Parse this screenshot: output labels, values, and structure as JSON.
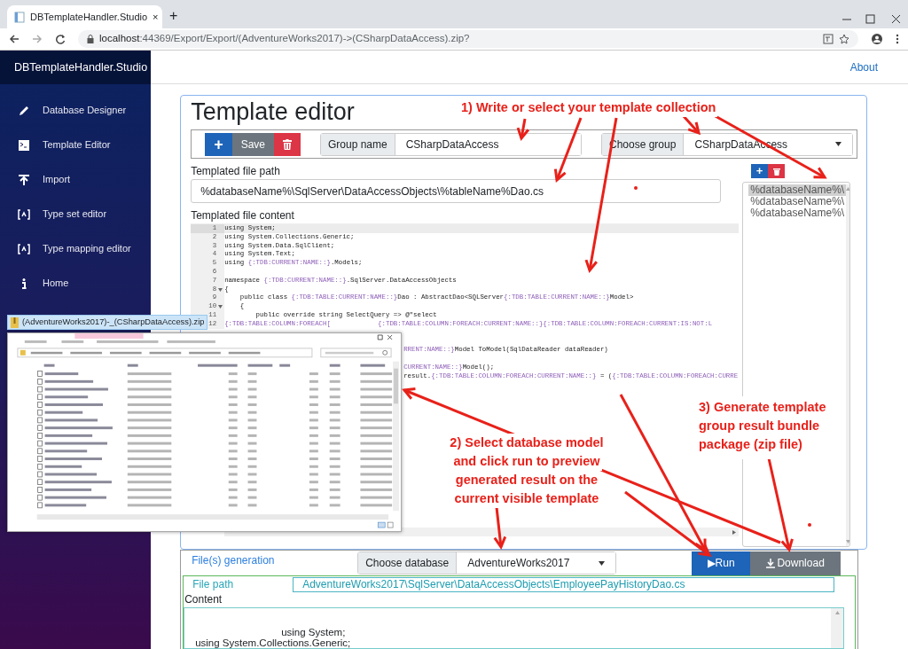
{
  "browser": {
    "tab_title": "DBTemplateHandler.Studio",
    "tab_close": "×",
    "new_tab": "+",
    "url_host": "localhost",
    "url_path": ":44369/Export/Export/(AdventureWorks2017)->(CSharpDataAccess).zip?"
  },
  "sidebar": {
    "brand": "DBTemplateHandler.Studio",
    "items": [
      {
        "label": "Database Designer",
        "kind": "pencil"
      },
      {
        "label": "Template Editor",
        "kind": "terminal"
      },
      {
        "label": "Import",
        "kind": "upload"
      },
      {
        "label": "Type set editor",
        "kind": "brackets"
      },
      {
        "label": "Type mapping editor",
        "kind": "brackets"
      },
      {
        "label": "Home",
        "kind": "info"
      }
    ]
  },
  "top_link": "About",
  "editor": {
    "title": "Template editor",
    "toolbar": {
      "add": "+",
      "save": "Save",
      "group_name_label": "Group name",
      "group_name": "CSharpDataAccess",
      "choose_group_label": "Choose group",
      "choose_group": "CSharpDataAccess"
    },
    "path_label": "Templated file path",
    "path": "%databaseName%\\SqlServer\\DataAccessObjects\\%tableName%Dao.cs",
    "content_label": "Templated file content",
    "list_add": "+",
    "templates": [
      {
        "label": "%databaseName%\\",
        "selected": true
      },
      {
        "label": "%databaseName%\\",
        "selected": false
      },
      {
        "label": "%databaseName%\\",
        "selected": false
      }
    ],
    "code": [
      {
        "number": "1",
        "selected": true,
        "parts": [
          {
            "text": "using System;",
            "token": false
          }
        ]
      },
      {
        "number": "2",
        "selected": false,
        "parts": [
          {
            "text": "using System.Collections.Generic;",
            "token": false
          }
        ]
      },
      {
        "number": "3",
        "selected": false,
        "parts": [
          {
            "text": "using System.Data.SqlClient;",
            "token": false
          }
        ]
      },
      {
        "number": "4",
        "selected": false,
        "parts": [
          {
            "text": "using System.Text;",
            "token": false
          }
        ]
      },
      {
        "number": "5",
        "selected": false,
        "parts": [
          {
            "text": "using ",
            "token": false
          },
          {
            "text": "{:TDB:CURRENT:NAME::}",
            "token": true
          },
          {
            "text": ".Models;",
            "token": false
          }
        ]
      },
      {
        "number": "6",
        "selected": false
      },
      {
        "number": "7",
        "selected": false,
        "parts": [
          {
            "text": "namespace ",
            "token": false
          },
          {
            "text": "{:TDB:CURRENT:NAME::}",
            "token": true
          },
          {
            "text": ".SqlServer.DataAccessObjects",
            "token": false
          }
        ]
      },
      {
        "number": "8",
        "selected": false,
        "fold": true,
        "parts": [
          {
            "text": "{",
            "token": false
          }
        ]
      },
      {
        "number": "9",
        "selected": false,
        "parts": [
          {
            "text": "    public class ",
            "token": false
          },
          {
            "text": "{:TDB:TABLE:CURRENT:NAME::}",
            "token": true
          },
          {
            "text": "Dao : AbstractDao<SQLServer",
            "token": false
          },
          {
            "text": "{:TDB:TABLE:CURRENT:NAME::}",
            "token": true
          },
          {
            "text": "Model>",
            "token": false
          }
        ]
      },
      {
        "number": "10",
        "selected": false,
        "fold": true,
        "parts": [
          {
            "text": "    {",
            "token": false
          }
        ]
      },
      {
        "number": "11",
        "selected": false,
        "parts": [
          {
            "text": "        public override string SelectQuery => @\"select",
            "token": false
          }
        ]
      },
      {
        "number": "12",
        "selected": false,
        "parts": [
          {
            "text": "{:TDB:TABLE:COLUMN:FOREACH[",
            "token": true
          },
          {
            "text": "            {:TDB:TABLE:COLUMN:FOREACH:CURRENT:NAME::}{:TDB:TABLE:COLUMN:FOREACH:CURRENT:IS:NOT:L",
            "token": true
          }
        ]
      },
      {
        "selected": false
      },
      {
        "selected": false
      },
      {
        "selected": false,
        "parts": [
          {
            "text": "RRENT:NAME::}",
            "token": true
          },
          {
            "text": "Model ToModel(SqlDataReader dataReader)",
            "token": false
          }
        ]
      },
      {
        "selected": false
      },
      {
        "selected": false,
        "parts": [
          {
            "text": "CURRENT:NAME::}",
            "token": true
          },
          {
            "text": "Model();",
            "token": false
          }
        ]
      },
      {
        "selected": false,
        "parts": [
          {
            "text": "result.",
            "token": false
          },
          {
            "text": "{:TDB:TABLE:COLUMN:FOREACH:CURRENT:NAME::}",
            "token": true
          },
          {
            "text": " = (",
            "token": false
          },
          {
            "text": "{:TDB:TABLE:COLUMN:FOREACH:CURRE",
            "token": true
          }
        ]
      }
    ]
  },
  "generation": {
    "title": "File(s) generation",
    "choose_database_label": "Choose database",
    "database": "AdventureWorks2017",
    "run": "▶Run",
    "download": "Download",
    "file_path_label": "File path",
    "file_path": "AdventureWorks2017\\SqlServer\\DataAccessObjects\\EmployeePayHistoryDao.cs",
    "content_label": "Content",
    "content_lines": [
      "using System;",
      "using System.Collections.Generic;"
    ]
  },
  "explorer": {
    "title": "(AdventureWorks2017)-_(CSharpDataAccess).zip"
  },
  "annotations": [
    {
      "lines": [
        "1) Write or select your template collection"
      ],
      "kind": "one"
    },
    {
      "lines": [
        "2) Select database model",
        "and click run to preview",
        "generated result on the",
        "current visible template"
      ],
      "kind": "two"
    },
    {
      "lines": [
        "3) Generate template",
        "group result bundle",
        "package (zip file)"
      ],
      "kind": "three"
    }
  ]
}
